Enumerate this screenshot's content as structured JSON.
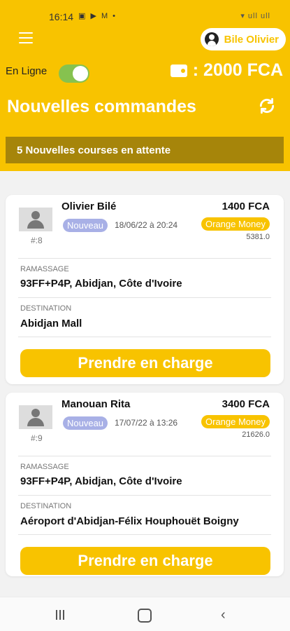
{
  "status_bar": {
    "time": "16:14",
    "left_icons": "▣ ▶ M •",
    "right_icons": "▾ ull ull"
  },
  "header": {
    "user_name": "Bile Olivier",
    "online_label": "En Ligne",
    "online_enabled": true,
    "wallet_amount": ": 2000 FCA",
    "page_title": "Nouvelles commandes",
    "pending_text": "5  Nouvelles courses en attente"
  },
  "labels": {
    "pickup": "RAMASSAGE",
    "destination": "DESTINATION",
    "take_charge": "Prendre en charge"
  },
  "orders": [
    {
      "customer": "Olivier Bilé",
      "status": "Nouveau",
      "date": "18/06/22 à 20:24",
      "order_number": "#:8",
      "price": "1400 FCA",
      "payment": "Orange Money",
      "distance": "5381.0",
      "pickup": "93FF+P4P, Abidjan, Côte d'Ivoire",
      "destination": "Abidjan Mall"
    },
    {
      "customer": "Manouan Rita",
      "status": "Nouveau",
      "date": "17/07/22 à 13:26",
      "order_number": "#:9",
      "price": "3400 FCA",
      "payment": "Orange Money",
      "distance": "21626.0",
      "pickup": "93FF+P4P, Abidjan, Côte d'Ivoire",
      "destination": "Aéroport d'Abidjan-Félix Houphouët Boigny"
    }
  ],
  "colors": {
    "brand_yellow": "#f8c300",
    "pending_bar": "#a6850a",
    "toggle_on": "#86c24f",
    "badge_new": "#a8b0e6"
  }
}
